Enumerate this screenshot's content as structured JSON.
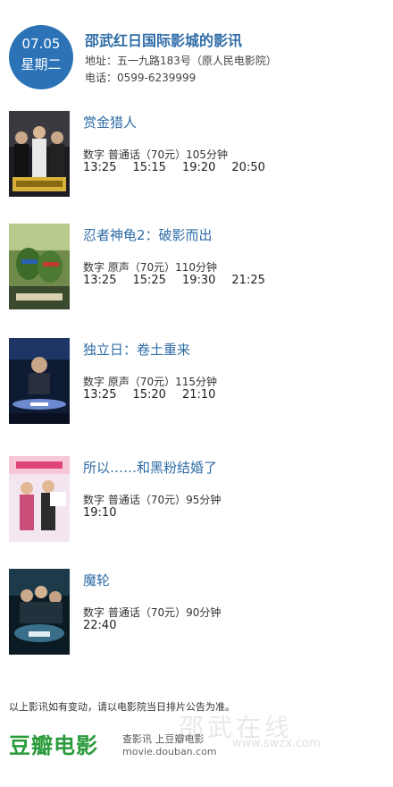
{
  "date": {
    "day": "07.05",
    "weekday": "星期二"
  },
  "cinema": {
    "name": "邵武红日国际影城的影讯",
    "address": "地址：五一九路183号（原人民电影院）",
    "phone": "电话：0599-6239999"
  },
  "movies": [
    {
      "title": "赏金猎人",
      "info": "数字  普通话（70元）105分钟",
      "times": [
        "13:25",
        "15:15",
        "19:20",
        "20:50"
      ]
    },
    {
      "title": "忍者神龟2：破影而出",
      "info": "数字  原声（70元）110分钟",
      "times": [
        "13:25",
        "15:25",
        "19:30",
        "21:25"
      ]
    },
    {
      "title": "独立日：卷土重来",
      "info": "数字  原声（70元）115分钟",
      "times": [
        "13:25",
        "15:20",
        "21:10"
      ]
    },
    {
      "title": "所以……和黑粉结婚了",
      "info": "数字  普通话（70元）95分钟",
      "times": [
        "19:10"
      ]
    },
    {
      "title": "魔轮",
      "info": "数字  普通话（70元）90分钟",
      "times": [
        "22:40"
      ]
    }
  ],
  "footer": {
    "note": "以上影讯如有变动，请以电影院当日排片公告为准。",
    "logo": "豆瓣电影",
    "tagline": "查影讯  上豆瓣电影",
    "url": "movie.douban.com"
  },
  "watermark": {
    "text": "邵武在线",
    "url": "www.swzx.com"
  }
}
